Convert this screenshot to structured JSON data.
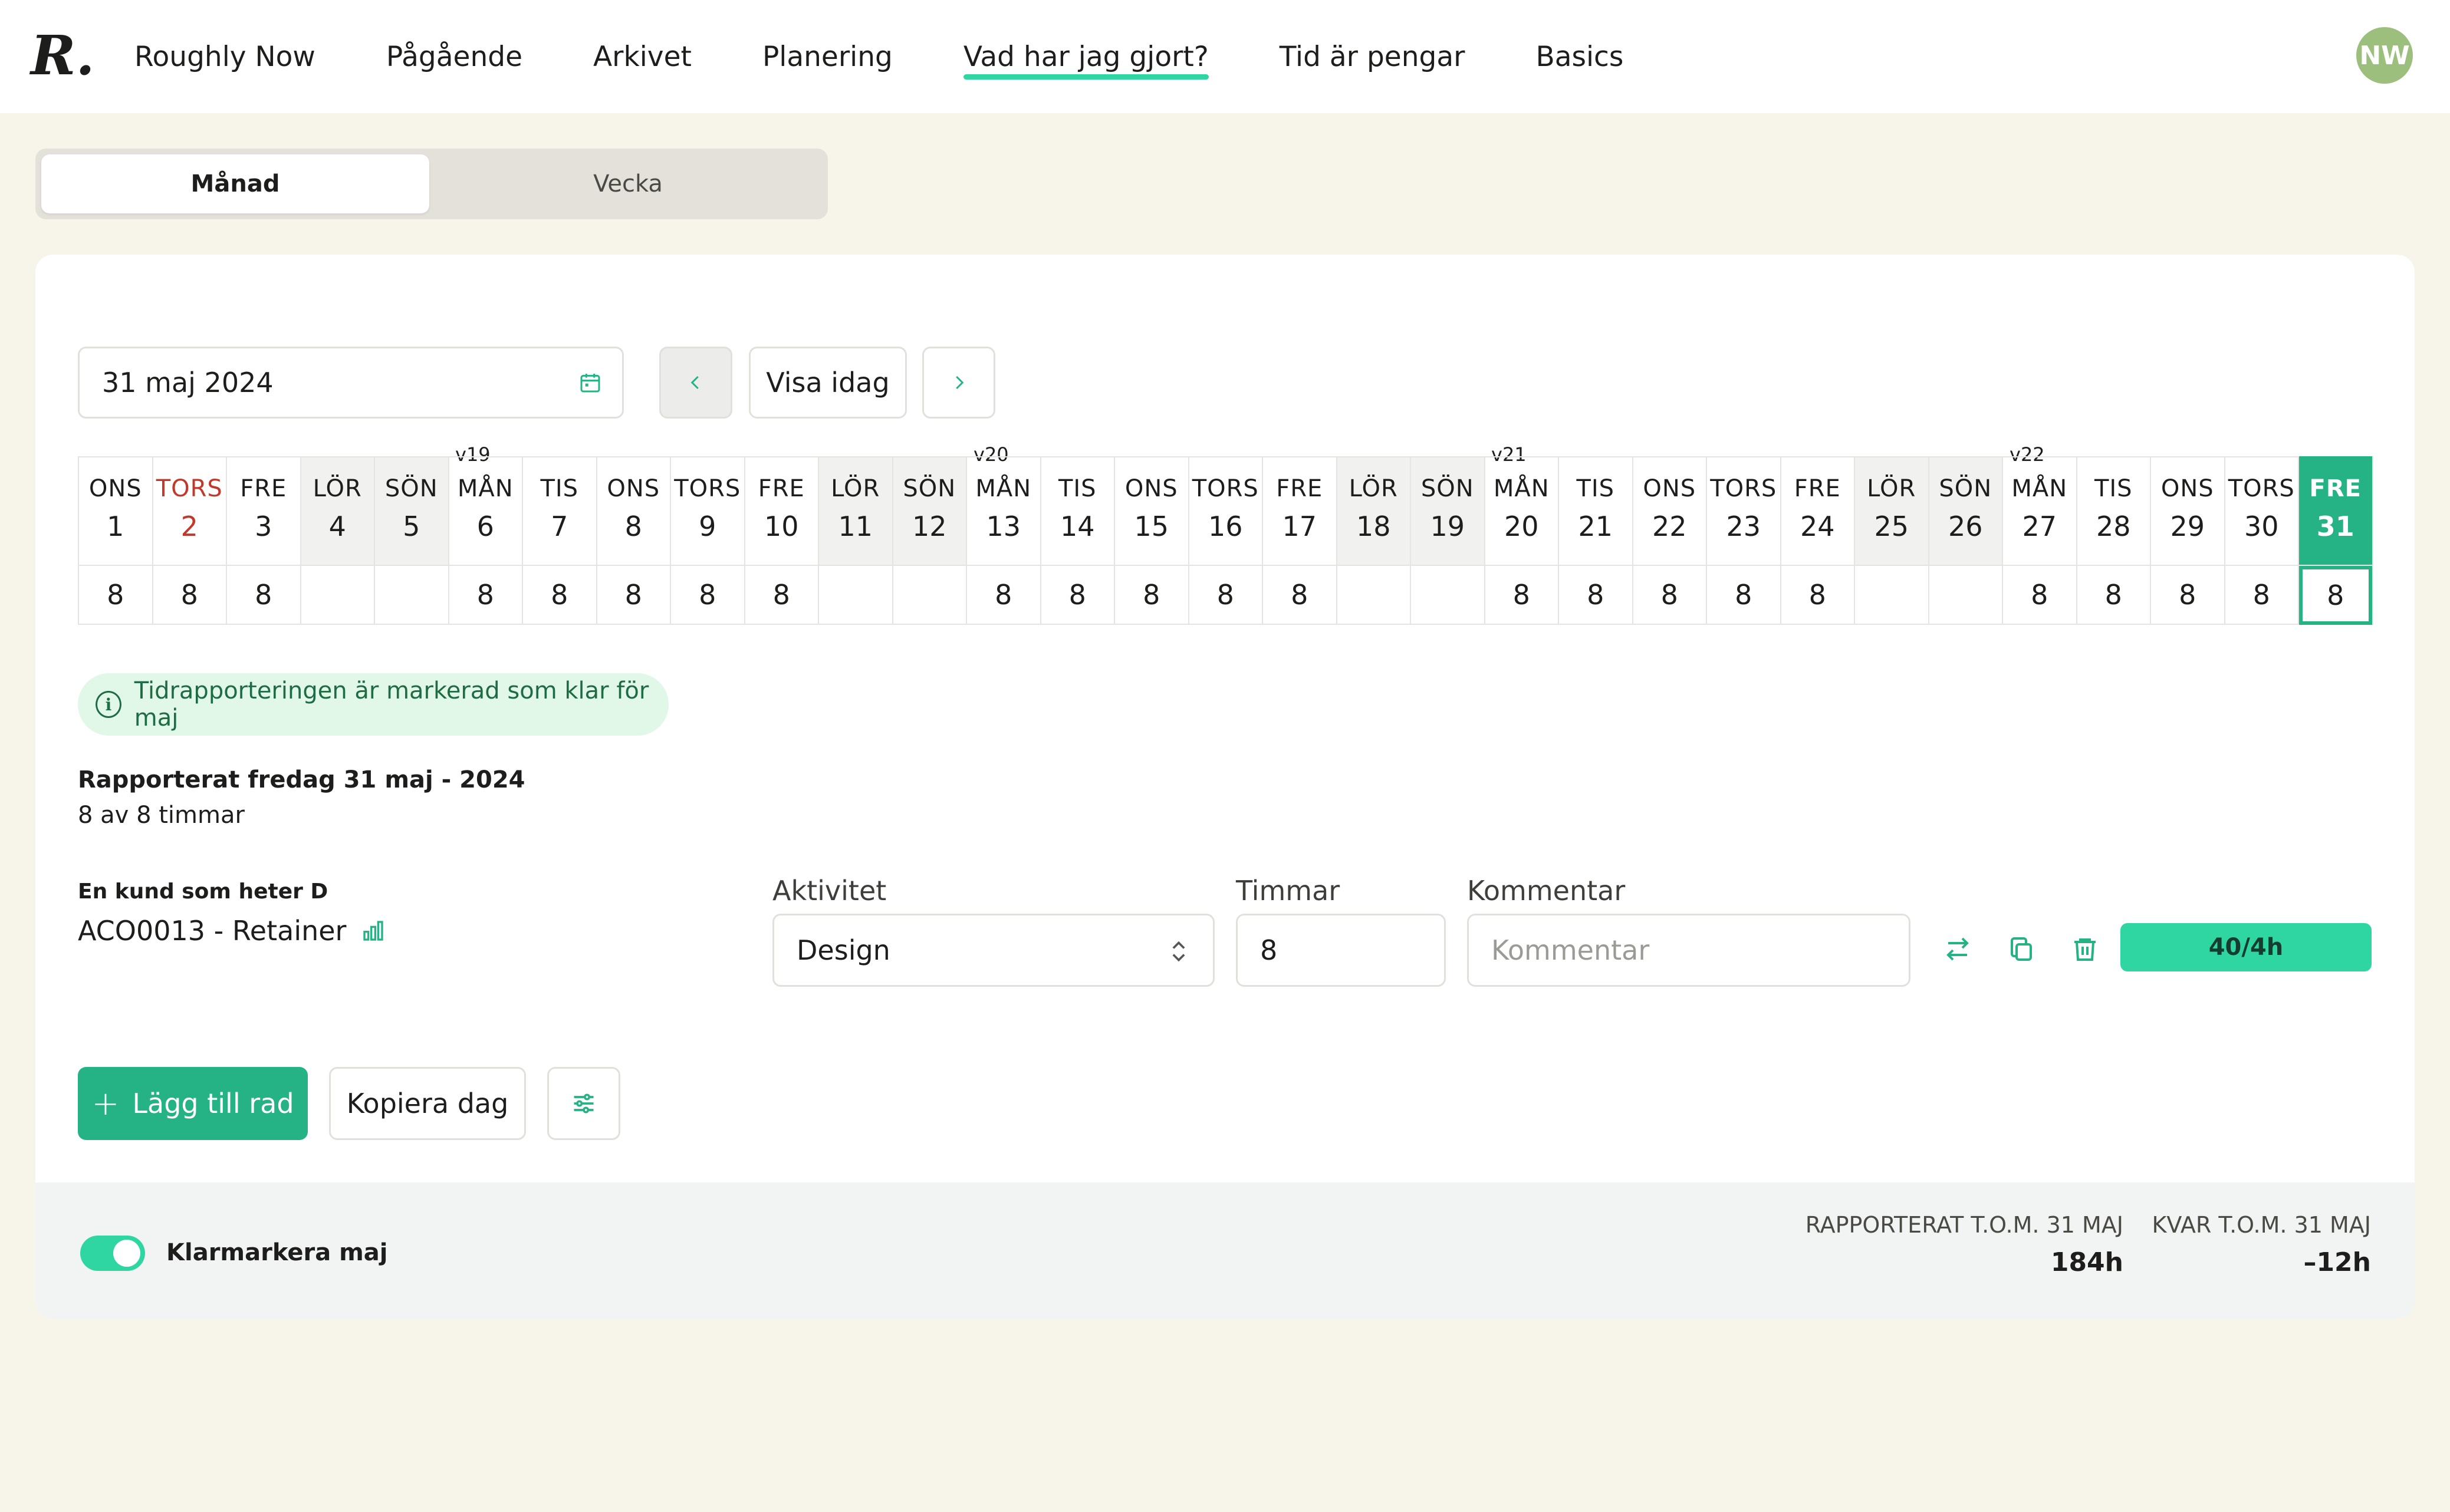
{
  "nav": {
    "logo": "R.",
    "items": [
      "Roughly Now",
      "Pågående",
      "Arkivet",
      "Planering",
      "Vad har jag gjort?",
      "Tid är pengar",
      "Basics"
    ],
    "active_index": 4,
    "avatar": "NW"
  },
  "view_toggle": {
    "month": "Månad",
    "week": "Vecka",
    "active": "Månad"
  },
  "date_picker": {
    "value": "31 maj 2024",
    "today_label": "Visa idag"
  },
  "calendar": {
    "weeks": [
      "v19",
      "v20",
      "v21",
      "v22"
    ],
    "days": [
      {
        "name": "ONS",
        "num": "1",
        "hours": "8",
        "weekend": false,
        "holiday": false
      },
      {
        "name": "TORS",
        "num": "2",
        "hours": "8",
        "weekend": false,
        "holiday": true
      },
      {
        "name": "FRE",
        "num": "3",
        "hours": "8",
        "weekend": false,
        "holiday": false
      },
      {
        "name": "LÖR",
        "num": "4",
        "hours": "",
        "weekend": true,
        "holiday": false
      },
      {
        "name": "SÖN",
        "num": "5",
        "hours": "",
        "weekend": true,
        "holiday": false
      },
      {
        "name": "MÅN",
        "num": "6",
        "hours": "8",
        "weekend": false,
        "holiday": false
      },
      {
        "name": "TIS",
        "num": "7",
        "hours": "8",
        "weekend": false,
        "holiday": false
      },
      {
        "name": "ONS",
        "num": "8",
        "hours": "8",
        "weekend": false,
        "holiday": false
      },
      {
        "name": "TORS",
        "num": "9",
        "hours": "8",
        "weekend": false,
        "holiday": false
      },
      {
        "name": "FRE",
        "num": "10",
        "hours": "8",
        "weekend": false,
        "holiday": false
      },
      {
        "name": "LÖR",
        "num": "11",
        "hours": "",
        "weekend": true,
        "holiday": false
      },
      {
        "name": "SÖN",
        "num": "12",
        "hours": "",
        "weekend": true,
        "holiday": false
      },
      {
        "name": "MÅN",
        "num": "13",
        "hours": "8",
        "weekend": false,
        "holiday": false
      },
      {
        "name": "TIS",
        "num": "14",
        "hours": "8",
        "weekend": false,
        "holiday": false
      },
      {
        "name": "ONS",
        "num": "15",
        "hours": "8",
        "weekend": false,
        "holiday": false
      },
      {
        "name": "TORS",
        "num": "16",
        "hours": "8",
        "weekend": false,
        "holiday": false
      },
      {
        "name": "FRE",
        "num": "17",
        "hours": "8",
        "weekend": false,
        "holiday": false
      },
      {
        "name": "LÖR",
        "num": "18",
        "hours": "",
        "weekend": true,
        "holiday": false
      },
      {
        "name": "SÖN",
        "num": "19",
        "hours": "",
        "weekend": true,
        "holiday": false
      },
      {
        "name": "MÅN",
        "num": "20",
        "hours": "8",
        "weekend": false,
        "holiday": false
      },
      {
        "name": "TIS",
        "num": "21",
        "hours": "8",
        "weekend": false,
        "holiday": false
      },
      {
        "name": "ONS",
        "num": "22",
        "hours": "8",
        "weekend": false,
        "holiday": false
      },
      {
        "name": "TORS",
        "num": "23",
        "hours": "8",
        "weekend": false,
        "holiday": false
      },
      {
        "name": "FRE",
        "num": "24",
        "hours": "8",
        "weekend": false,
        "holiday": false
      },
      {
        "name": "LÖR",
        "num": "25",
        "hours": "",
        "weekend": true,
        "holiday": false
      },
      {
        "name": "SÖN",
        "num": "26",
        "hours": "",
        "weekend": true,
        "holiday": false
      },
      {
        "name": "MÅN",
        "num": "27",
        "hours": "8",
        "weekend": false,
        "holiday": false
      },
      {
        "name": "TIS",
        "num": "28",
        "hours": "8",
        "weekend": false,
        "holiday": false
      },
      {
        "name": "ONS",
        "num": "29",
        "hours": "8",
        "weekend": false,
        "holiday": false
      },
      {
        "name": "TORS",
        "num": "30",
        "hours": "8",
        "weekend": false,
        "holiday": false
      },
      {
        "name": "FRE",
        "num": "31",
        "hours": "8",
        "weekend": false,
        "holiday": false,
        "selected": true
      }
    ]
  },
  "info": {
    "text": "Tidrapporteringen är markerad som klar för maj"
  },
  "report": {
    "title": "Rapporterat fredag 31 maj - 2024",
    "subtitle": "8 av 8 timmar"
  },
  "entry": {
    "client": "En kund som heter D",
    "project": "ACO0013 - Retainer",
    "activity_label": "Aktivitet",
    "activity_value": "Design",
    "hours_label": "Timmar",
    "hours_value": "8",
    "comment_label": "Kommentar",
    "comment_placeholder": "Kommentar",
    "budget": "40/4h"
  },
  "actions": {
    "add_row": "Lägg till rad",
    "copy_day": "Kopiera dag"
  },
  "footer": {
    "toggle_label": "Klarmarkera maj",
    "toggle_on": true,
    "reported_label": "RAPPORTERAT T.O.M. 31 MAJ",
    "reported_value": "184h",
    "remaining_label": "KVAR T.O.M. 31 MAJ",
    "remaining_value": "–12h"
  },
  "colors": {
    "accent": "#25b386",
    "accent_light": "#2fd6a2",
    "background": "#f7f5ea",
    "holiday": "#c0392b"
  }
}
